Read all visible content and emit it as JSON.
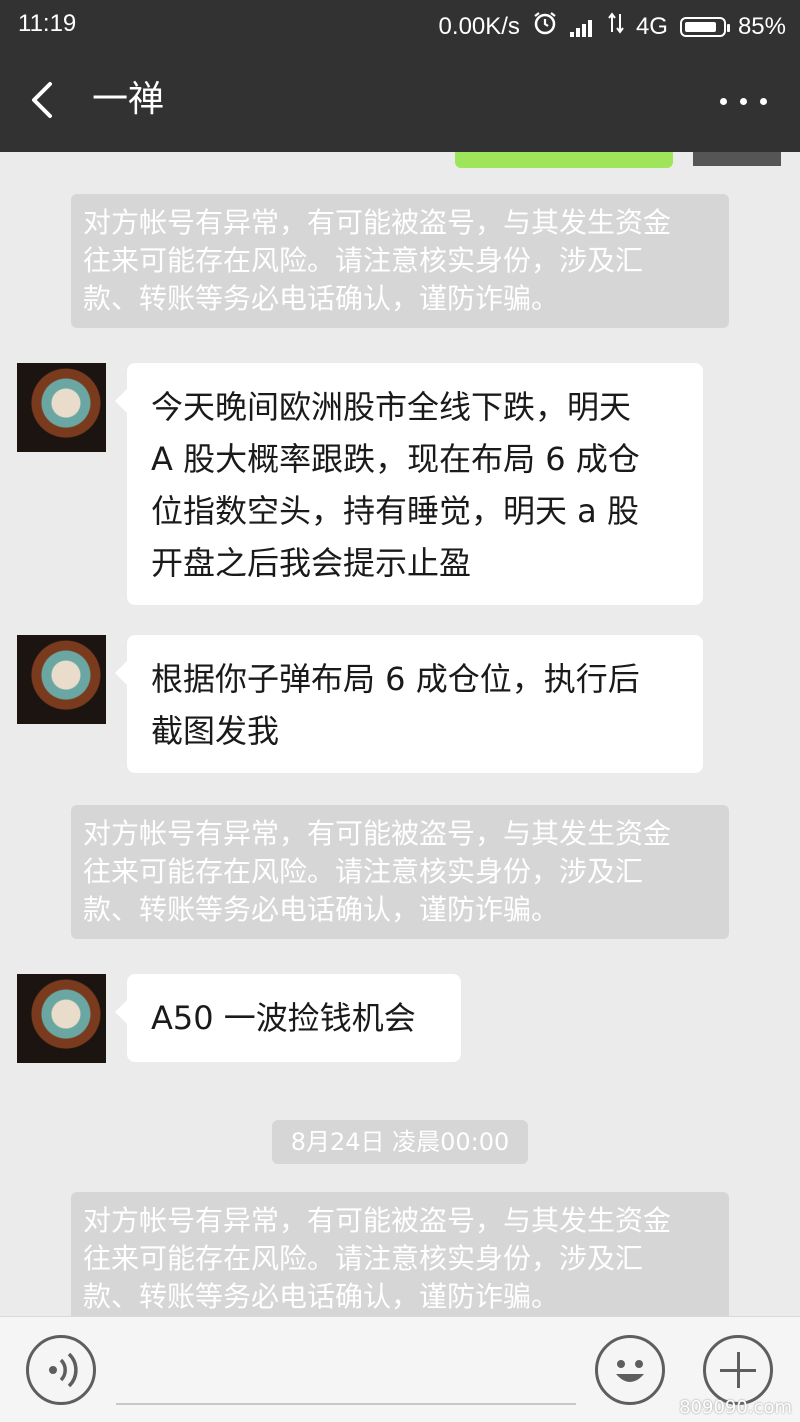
{
  "status_bar": {
    "time": "11:19",
    "speed": "0.00K/s",
    "network": "4G",
    "battery_percent": "85%",
    "battery_level": 0.85,
    "icons": [
      "alarm-icon",
      "signal-icon",
      "data-arrows-icon",
      "battery-icon"
    ]
  },
  "header": {
    "title": "一禅",
    "icons": [
      "back-arrow-icon",
      "more-dots-icon"
    ]
  },
  "messages": [
    {
      "type": "system",
      "lines": [
        "对方帐号有异常，有可能被盗号，与其发生资金",
        "往来可能存在风险。请注意核实身份，涉及汇",
        "款、转账等务必电话确认，谨防诈骗。"
      ]
    },
    {
      "type": "received",
      "lines": [
        "今天晚间欧洲股市全线下跌，明天",
        "A 股大概率跟跌，现在布局 6 成仓",
        "位指数空头，持有睡觉，明天 a 股",
        "开盘之后我会提示止盈"
      ]
    },
    {
      "type": "received",
      "lines": [
        "根据你子弹布局 6 成仓位，执行后",
        "截图发我"
      ]
    },
    {
      "type": "system",
      "lines": [
        "对方帐号有异常，有可能被盗号，与其发生资金",
        "往来可能存在风险。请注意核实身份，涉及汇",
        "款、转账等务必电话确认，谨防诈骗。"
      ]
    },
    {
      "type": "received",
      "lines": [
        "A50 一波捡钱机会"
      ]
    },
    {
      "type": "timestamp",
      "text": "8月24日 凌晨00:00"
    },
    {
      "type": "system",
      "lines": [
        "对方帐号有异常，有可能被盗号，与其发生资金",
        "往来可能存在风险。请注意核实身份，涉及汇",
        "款、转账等务必电话确认，谨防诈骗。"
      ]
    }
  ],
  "input_bar": {
    "icons": [
      "voice-icon",
      "emoji-icon",
      "plus-icon"
    ]
  },
  "colors": {
    "bar_bg": "#323232",
    "chat_bg": "#ebebeb",
    "system_note_bg": "#d6d6d6",
    "bubble_bg": "#ffffff",
    "sent_bubble": "#9ee55c"
  },
  "watermark": "809090.com"
}
